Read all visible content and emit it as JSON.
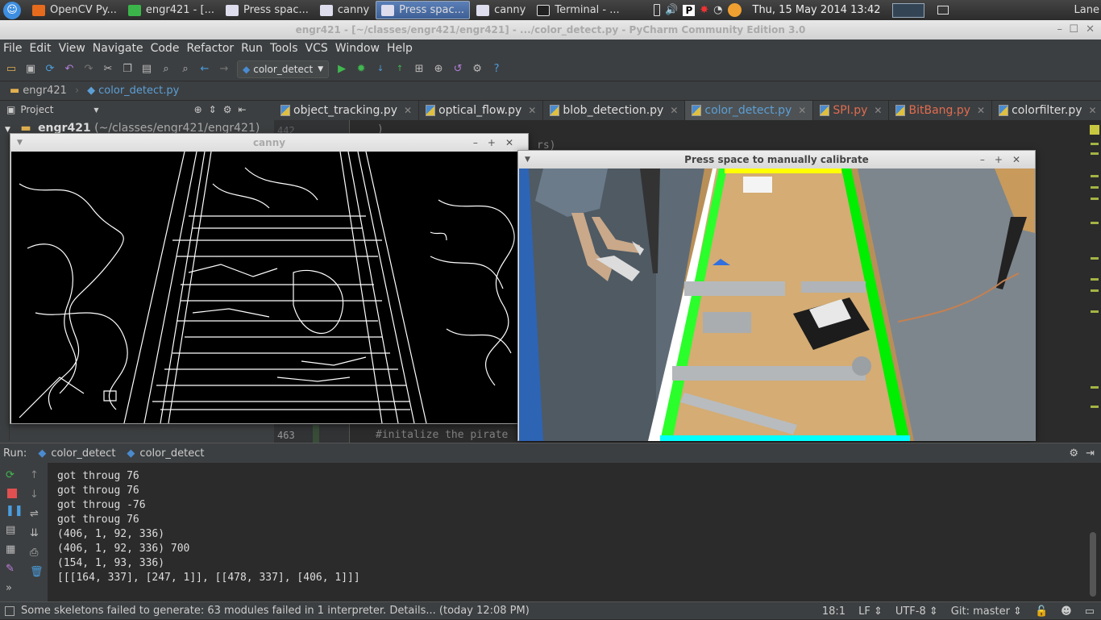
{
  "taskbar": {
    "tasks": [
      {
        "label": "OpenCV Py...",
        "icon": "firefox-icon",
        "active": false
      },
      {
        "label": "engr421 - [...",
        "icon": "pycharm-icon",
        "active": false
      },
      {
        "label": "Press spac...",
        "icon": "window-icon",
        "active": false
      },
      {
        "label": "canny",
        "icon": "window-icon",
        "active": false
      },
      {
        "label": "Press spac...",
        "icon": "window-icon",
        "active": true
      },
      {
        "label": "canny",
        "icon": "window-icon",
        "active": false
      },
      {
        "label": "Terminal - ...",
        "icon": "terminal-icon",
        "active": false
      }
    ],
    "clock": "Thu, 15 May 2014 13:42",
    "user": "Lane"
  },
  "window": {
    "title": "engr421 - [~/classes/engr421/engr421] - .../color_detect.py - PyCharm Community Edition 3.0"
  },
  "menu": [
    "File",
    "Edit",
    "View",
    "Navigate",
    "Code",
    "Refactor",
    "Run",
    "Tools",
    "VCS",
    "Window",
    "Help"
  ],
  "toolbar": {
    "run_config": "color_detect"
  },
  "nav": {
    "project": "engr421",
    "file": "color_detect.py"
  },
  "project_panel": {
    "header": "Project",
    "root": "engr421",
    "root_path": "(~/classes/engr421/engr421)"
  },
  "tabs": [
    {
      "label": "object_tracking.py",
      "active": false,
      "color": "#dddddd"
    },
    {
      "label": "optical_flow.py",
      "active": false,
      "color": "#dddddd"
    },
    {
      "label": "blob_detection.py",
      "active": false,
      "color": "#dddddd"
    },
    {
      "label": "color_detect.py",
      "active": true,
      "color": "#5c9fd6"
    },
    {
      "label": "SPI.py",
      "active": false,
      "color": "#e06c4f"
    },
    {
      "label": "BitBang.py",
      "active": false,
      "color": "#e06c4f"
    },
    {
      "label": "colorfilter.py",
      "active": false,
      "color": "#dddddd"
    }
  ],
  "editor": {
    "line_top": "442",
    "code_top": ")",
    "code_mid": "rs)",
    "line_bottom": "463",
    "code_bottom": "#initalize the pirate"
  },
  "canny_window": {
    "title": "canny"
  },
  "calib_window": {
    "title": "Press space to manually calibrate"
  },
  "run": {
    "label": "Run:",
    "tabs": [
      "color_detect",
      "color_detect"
    ],
    "output": [
      "got throug 76",
      "got throug 76",
      "got throug -76",
      "got throug 76",
      "(406, 1, 92, 336)",
      "(406, 1, 92, 336) 700",
      "(154, 1, 93, 336)",
      "[[[164, 337], [247, 1]], [[478, 337], [406, 1]]]"
    ]
  },
  "status": {
    "message": "Some skeletons failed to generate: 63 modules failed in 1 interpreter. Details... (today 12:08 PM)",
    "position": "18:1",
    "line_sep": "LF",
    "encoding": "UTF-8",
    "vcs": "Git: master"
  }
}
